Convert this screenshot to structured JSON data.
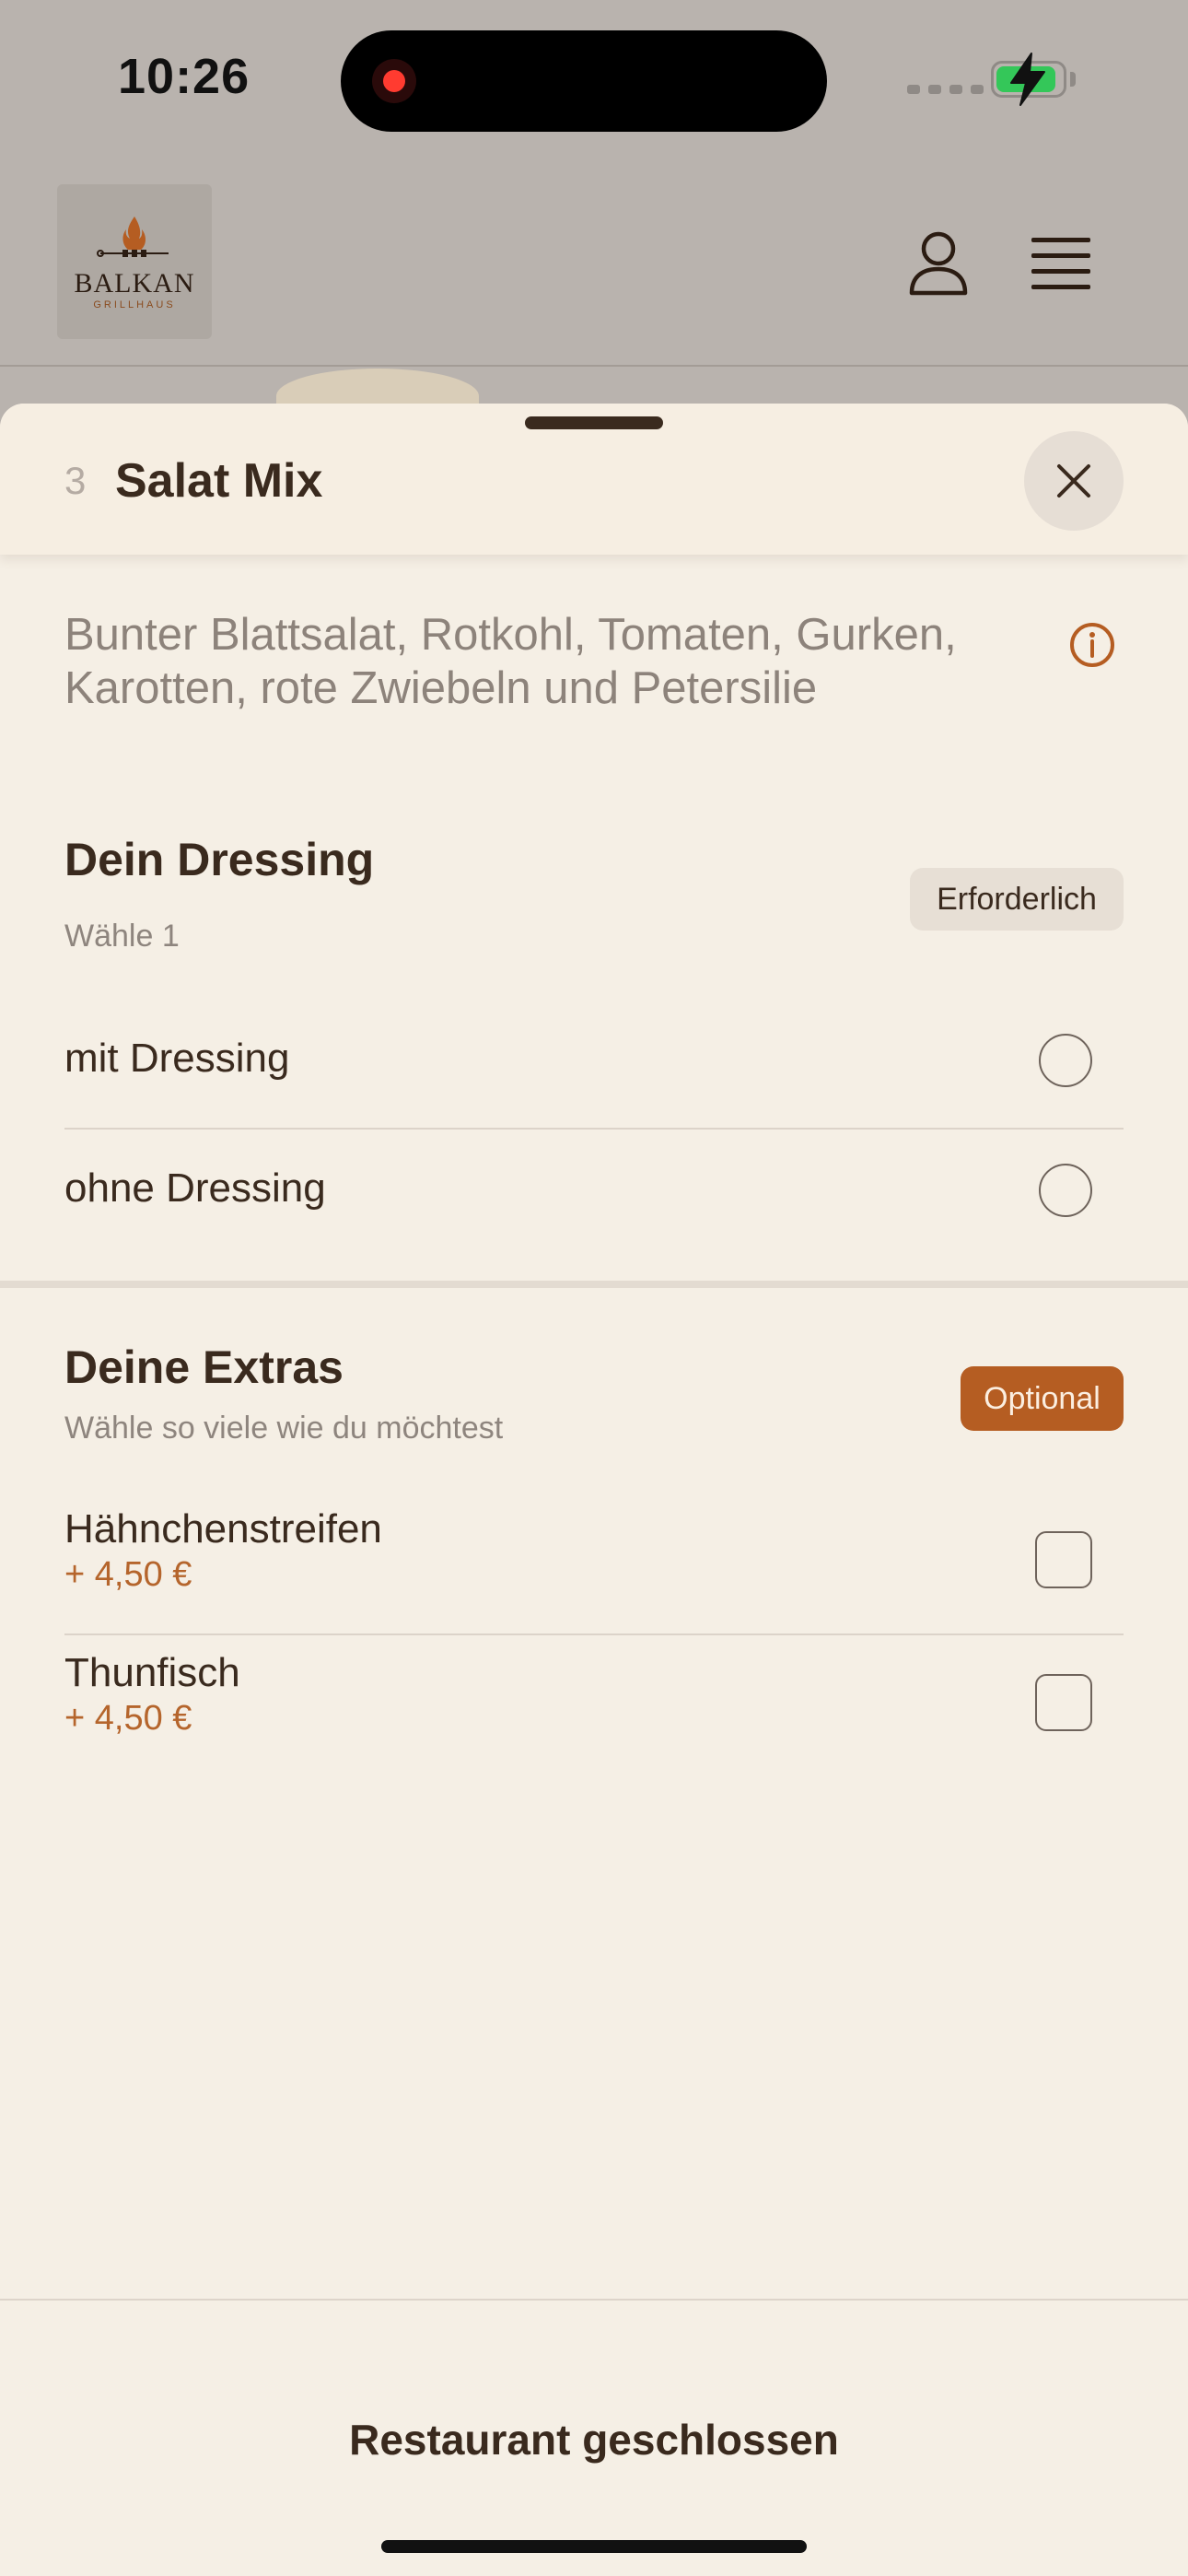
{
  "status_bar": {
    "time": "10:26"
  },
  "header": {
    "brand_name": "BALKAN",
    "brand_sub": "GRILLHAUS",
    "user_icon": "user-icon",
    "menu_icon": "menu-icon"
  },
  "sheet": {
    "item_number": "3",
    "item_title": "Salat Mix",
    "description": "Bunter Blattsalat, Rotkohl, Tomaten, Gurken, Karotten, rote Zwiebeln und Petersilie",
    "sections": [
      {
        "title": "Dein Dressing",
        "subtitle": "Wähle 1",
        "badge": "Erforderlich",
        "options": [
          {
            "label": "mit Dressing",
            "selected": false
          },
          {
            "label": "ohne Dressing",
            "selected": false
          }
        ]
      },
      {
        "title": "Deine Extras",
        "subtitle": "Wähle so viele wie du möchtest",
        "badge": "Optional",
        "options": [
          {
            "label": "Hähnchenstreifen",
            "price": "+ 4,50 €",
            "checked": false
          },
          {
            "label": "Thunfisch",
            "price": "+ 4,50 €",
            "checked": false
          }
        ]
      }
    ],
    "footer_text": "Restaurant geschlossen"
  },
  "colors": {
    "accent": "#b55d22",
    "sheet_background": "#f5efe5",
    "text": "#3a2a1e"
  }
}
